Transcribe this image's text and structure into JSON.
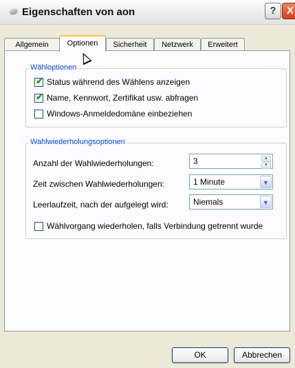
{
  "window": {
    "title": "Eigenschaften von aon",
    "help": "?",
    "close": "X"
  },
  "tabs": [
    "Allgemein",
    "Optionen",
    "Sicherheit",
    "Netzwerk",
    "Erweitert"
  ],
  "active_tab": "Optionen",
  "dial_options": {
    "title": "Wähloptionen",
    "items": [
      {
        "label": "Status während des Wählens anzeigen",
        "checked": true
      },
      {
        "label": "Name, Kennwort, Zertifikat usw. abfragen",
        "checked": true
      },
      {
        "label": "Windows-Anmeldedomäne einbeziehen",
        "checked": false
      }
    ]
  },
  "redial_options": {
    "title": "Wahlwiederholungsoptionen",
    "attempts_label": "Anzahl der Wahlwiederholungen:",
    "attempts_value": "3",
    "interval_label": "Zeit zwischen Wahlwiederholungen:",
    "interval_value": "1 Minute",
    "idle_label": "Leerlaufzeit, nach der aufgelegt wird:",
    "idle_value": "Niemals",
    "redial_drop_label": "Wählvorgang wiederholen, falls Verbindung getrennt wurde",
    "redial_drop_checked": false
  },
  "buttons": {
    "ok": "OK",
    "cancel": "Abbrechen"
  },
  "icons": {
    "check": "✔",
    "spin_up": "▲",
    "spin_down": "▼",
    "dropdown": "▼"
  }
}
